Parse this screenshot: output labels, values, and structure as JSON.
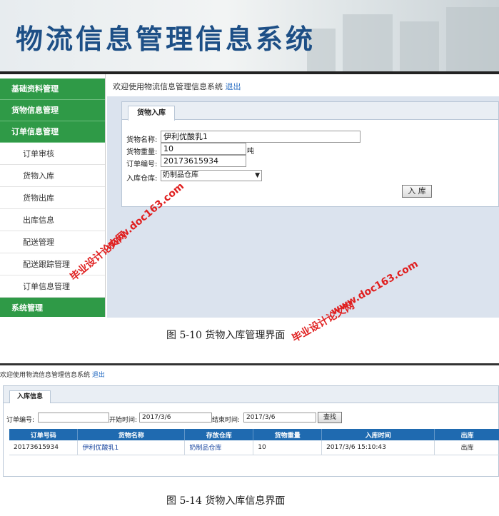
{
  "banner": {
    "title": "物流信息管理信息系统"
  },
  "sidebar": {
    "groups": [
      {
        "label": "基础资料管理"
      },
      {
        "label": "货物信息管理"
      },
      {
        "label": "订单信息管理"
      }
    ],
    "items": [
      {
        "label": "订单审核"
      },
      {
        "label": "货物入库"
      },
      {
        "label": "货物出库"
      },
      {
        "label": "出库信息"
      },
      {
        "label": "配送管理"
      },
      {
        "label": "配送跟踪管理"
      },
      {
        "label": "订单信息管理"
      }
    ],
    "last_group": "系统管理"
  },
  "header": {
    "welcome": "欢迎使用物流信息管理信息系统",
    "logout": "退出"
  },
  "form": {
    "tab": "货物入库",
    "name_label": "货物名称:",
    "name_value": "伊利优酸乳1",
    "weight_label": "货物重量:",
    "weight_value": "10",
    "weight_unit": "吨",
    "order_label": "订单编号:",
    "order_value": "20173615934",
    "warehouse_label": "入库仓库:",
    "warehouse_value": "奶制品仓库",
    "submit": "入 库"
  },
  "captions": {
    "fig1": "图 5-10 货物入库管理界面",
    "fig2": "图 5-14 货物入库信息界面"
  },
  "watermarks": {
    "site": "www.doc163.com",
    "brand": "毕业设计论文网"
  },
  "screen2": {
    "welcome": "欢迎使用物流信息管理信息系统",
    "logout": "退出",
    "tab": "入库信息",
    "search": {
      "order_label": "订单编号:",
      "order_value": "",
      "start_label": "开始时间:",
      "start_value": "2017/3/6",
      "end_label": "结束时间:",
      "end_value": "2017/3/6",
      "button": "查找"
    },
    "table": {
      "headers": [
        "订单号码",
        "货物名称",
        "存放仓库",
        "货物重量",
        "入库时间",
        "出库"
      ],
      "rows": [
        [
          "20173615934",
          "伊利优酸乳1",
          "奶制品仓库",
          "10",
          "2017/3/6 15:10:43",
          "出库"
        ]
      ]
    }
  }
}
